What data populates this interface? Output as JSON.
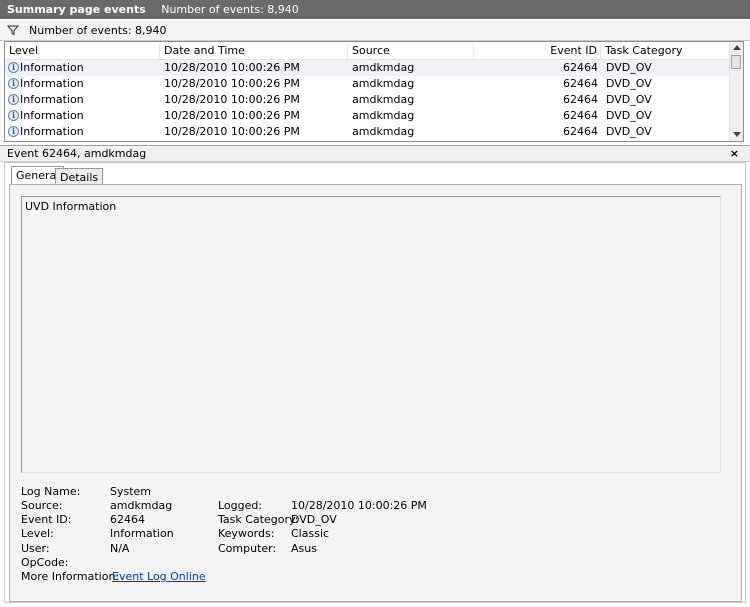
{
  "title": {
    "main": "Summary page events",
    "count": "Number of events: 8,940"
  },
  "filter": {
    "count": "Number of events: 8,940"
  },
  "columns": {
    "level": "Level",
    "datetime": "Date and Time",
    "source": "Source",
    "eventid": "Event ID",
    "category": "Task Category"
  },
  "rows": [
    {
      "level": "Information",
      "datetime": "10/28/2010 10:00:26 PM",
      "source": "amdkmdag",
      "eventid": "62464",
      "category": "DVD_OV"
    },
    {
      "level": "Information",
      "datetime": "10/28/2010 10:00:26 PM",
      "source": "amdkmdag",
      "eventid": "62464",
      "category": "DVD_OV"
    },
    {
      "level": "Information",
      "datetime": "10/28/2010 10:00:26 PM",
      "source": "amdkmdag",
      "eventid": "62464",
      "category": "DVD_OV"
    },
    {
      "level": "Information",
      "datetime": "10/28/2010 10:00:26 PM",
      "source": "amdkmdag",
      "eventid": "62464",
      "category": "DVD_OV"
    },
    {
      "level": "Information",
      "datetime": "10/28/2010 10:00:26 PM",
      "source": "amdkmdag",
      "eventid": "62464",
      "category": "DVD_OV"
    }
  ],
  "detail": {
    "header": "Event 62464, amdkmdag",
    "close": "×",
    "tabs": {
      "general": "General",
      "details": "Details"
    },
    "description": "UVD Information",
    "labels": {
      "log_name": "Log Name:",
      "source": "Source:",
      "event_id": "Event ID:",
      "level": "Level:",
      "user": "User:",
      "opcode": "OpCode:",
      "more_info": "More Information:",
      "logged": "Logged:",
      "task_category": "Task Category:",
      "keywords": "Keywords:",
      "computer": "Computer:"
    },
    "values": {
      "log_name": "System",
      "source": "amdkmdag",
      "event_id": "62464",
      "level": "Information",
      "user": "N/A",
      "opcode": "",
      "more_info": "Event Log Online",
      "logged": "10/28/2010 10:00:26 PM",
      "task_category": "DVD_OV",
      "keywords": "Classic",
      "computer": "Asus"
    }
  }
}
